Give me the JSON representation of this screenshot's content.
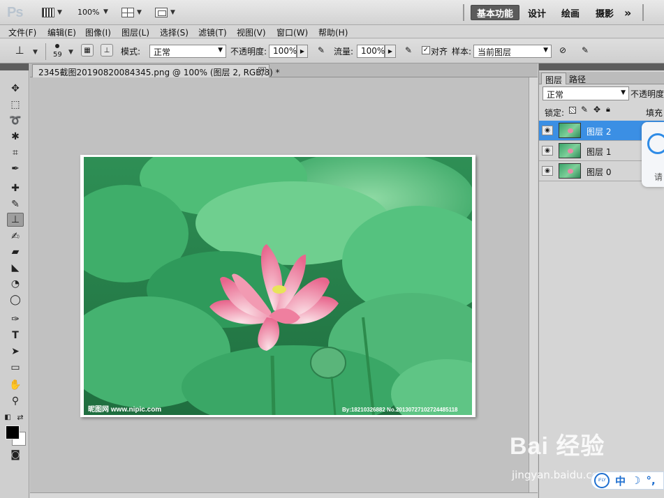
{
  "app": {
    "logo": "Ps",
    "zoom": "100%",
    "workspaces": [
      "基本功能",
      "设计",
      "绘画",
      "摄影"
    ],
    "more": "»"
  },
  "menu": [
    "文件(F)",
    "编辑(E)",
    "图像(I)",
    "图层(L)",
    "选择(S)",
    "滤镜(T)",
    "视图(V)",
    "窗口(W)",
    "帮助(H)"
  ],
  "options": {
    "brush_size": "59",
    "mode_label": "模式:",
    "mode_value": "正常",
    "opacity_label": "不透明度:",
    "opacity_value": "100%",
    "flow_label": "流量:",
    "flow_value": "100%",
    "aligned_label": "对齐",
    "aligned_checked": true,
    "sample_label": "样本:",
    "sample_value": "当前图层"
  },
  "document": {
    "tab_title": "2345截图20190820084345.png @ 100% (图层 2, RGB/8) *",
    "close": "×"
  },
  "photo": {
    "watermark_left": "昵图网 www.nipic.com",
    "watermark_right": "By:18210326882  No.20130727102724485118"
  },
  "layers_panel": {
    "tabs": [
      "图层",
      "路径"
    ],
    "blend_mode": "正常",
    "opacity_label": "不透明度",
    "lock_label": "锁定:",
    "fill_label": "填充",
    "layers": [
      {
        "name": "图层 2",
        "selected": true
      },
      {
        "name": "图层 1",
        "selected": false
      },
      {
        "name": "图层 0",
        "selected": false
      }
    ]
  },
  "floating_card": {
    "text": "请"
  },
  "overlay": {
    "baidu_logo": "Bai 经验",
    "baidu_url": "jingyan.baidu.com",
    "ime_logo": "iFLY",
    "ime_mode": "中",
    "ime_moon": "☽",
    "ime_dot": "°,"
  },
  "colors": {
    "selected_layer": "#3b8fe4",
    "leaf_green": "#3fae6a",
    "lotus_pink": "#ef7f9f"
  }
}
